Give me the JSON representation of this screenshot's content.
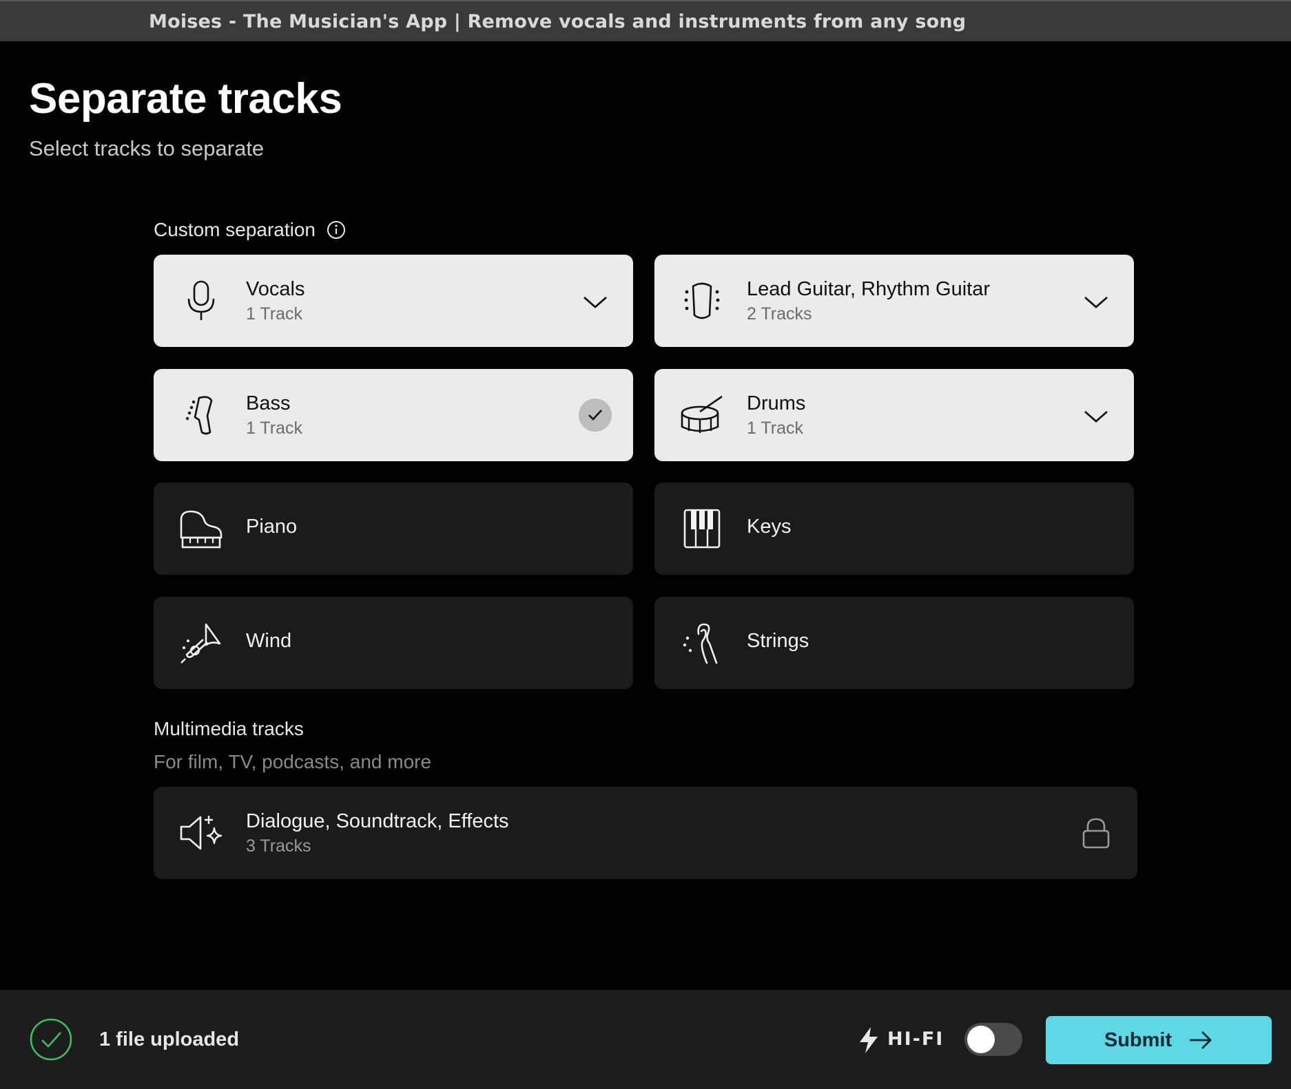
{
  "window": {
    "title": "Moises - The Musician's App | Remove vocals and instruments from any song"
  },
  "header": {
    "title": "Separate tracks",
    "subtitle": "Select tracks to separate"
  },
  "custom": {
    "label": "Custom separation",
    "info_icon": "info-icon",
    "cards": [
      {
        "name": "Vocals",
        "count": "1 Track",
        "icon": "microphone-icon",
        "state": "expandable"
      },
      {
        "name": "Lead Guitar, Rhythm Guitar",
        "count": "2 Tracks",
        "icon": "guitar-icon",
        "state": "expandable"
      },
      {
        "name": "Bass",
        "count": "1 Track",
        "icon": "bass-icon",
        "state": "selected"
      },
      {
        "name": "Drums",
        "count": "1 Track",
        "icon": "drum-icon",
        "state": "expandable"
      },
      {
        "name": "Piano",
        "icon": "piano-icon",
        "state": "unselected"
      },
      {
        "name": "Keys",
        "icon": "keys-icon",
        "state": "unselected"
      },
      {
        "name": "Wind",
        "icon": "trumpet-icon",
        "state": "unselected"
      },
      {
        "name": "Strings",
        "icon": "violin-icon",
        "state": "unselected"
      }
    ]
  },
  "multimedia": {
    "label": "Multimedia tracks",
    "subtitle": "For film, TV, podcasts, and more",
    "card": {
      "name": "Dialogue, Soundtrack, Effects",
      "count": "3 Tracks",
      "icon": "speaker-sparkle-icon",
      "state": "locked"
    }
  },
  "footer": {
    "upload_status": "1 file uploaded",
    "hifi_label": "HI-FI",
    "hifi_enabled": false,
    "submit_label": "Submit"
  },
  "colors": {
    "background": "#000000",
    "selected_card": "#ebebeb",
    "unselected_card": "#1b1b1b",
    "accent": "#5fd8e6",
    "success": "#3fbf5f"
  }
}
